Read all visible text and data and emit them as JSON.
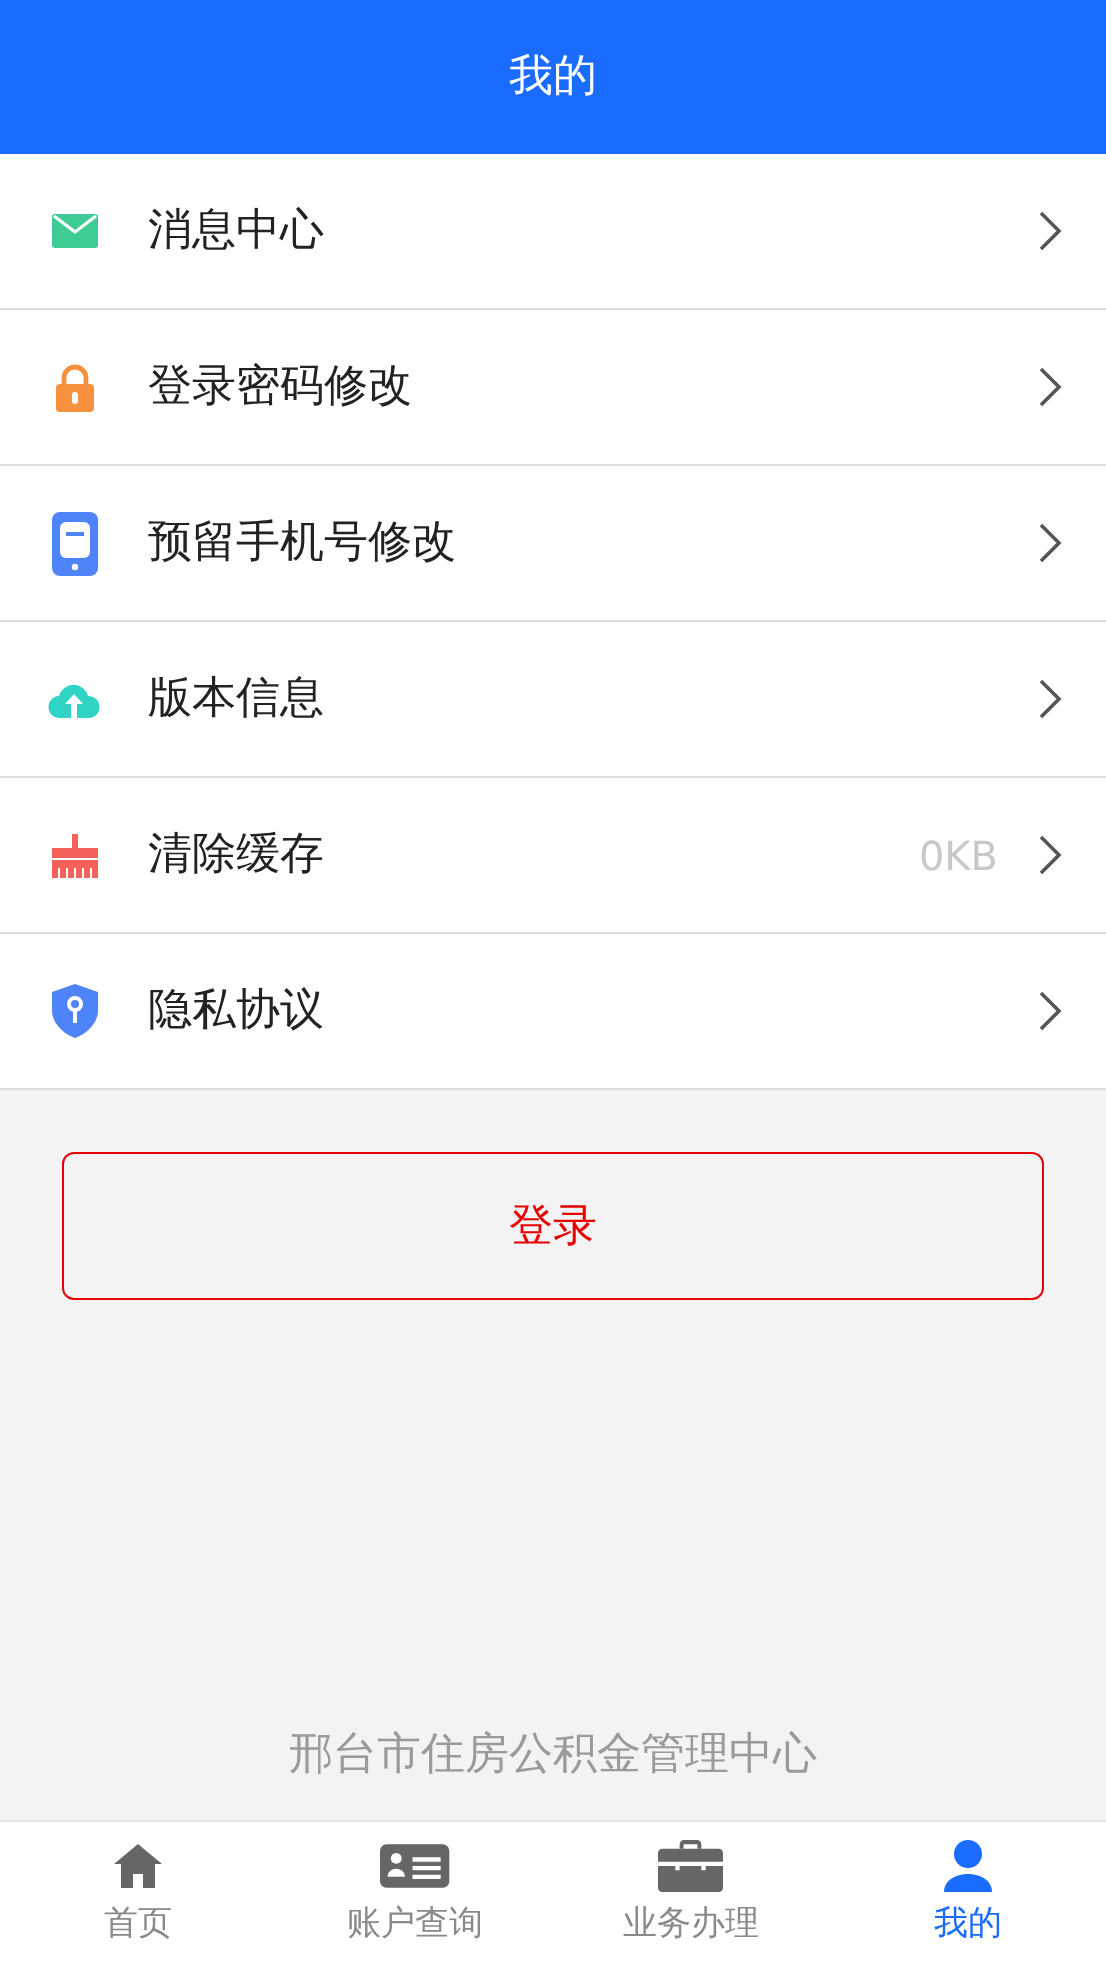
{
  "header": {
    "title": "我的"
  },
  "menu": [
    {
      "kind": "mail",
      "label": "消息中心"
    },
    {
      "kind": "lock",
      "label": "登录密码修改"
    },
    {
      "kind": "phone",
      "label": "预留手机号修改"
    },
    {
      "kind": "cloud",
      "label": "版本信息"
    },
    {
      "kind": "brush",
      "label": "清除缓存",
      "value": "0KB"
    },
    {
      "kind": "shield",
      "label": "隐私协议"
    }
  ],
  "login_button": "登录",
  "footer": "邢台市住房公积金管理中心",
  "tabs": [
    {
      "kind": "home",
      "label": "首页",
      "selected": false
    },
    {
      "kind": "card",
      "label": "账户查询",
      "selected": false
    },
    {
      "kind": "briefcase",
      "label": "业务办理",
      "selected": false
    },
    {
      "kind": "person",
      "label": "我的",
      "selected": true
    }
  ]
}
